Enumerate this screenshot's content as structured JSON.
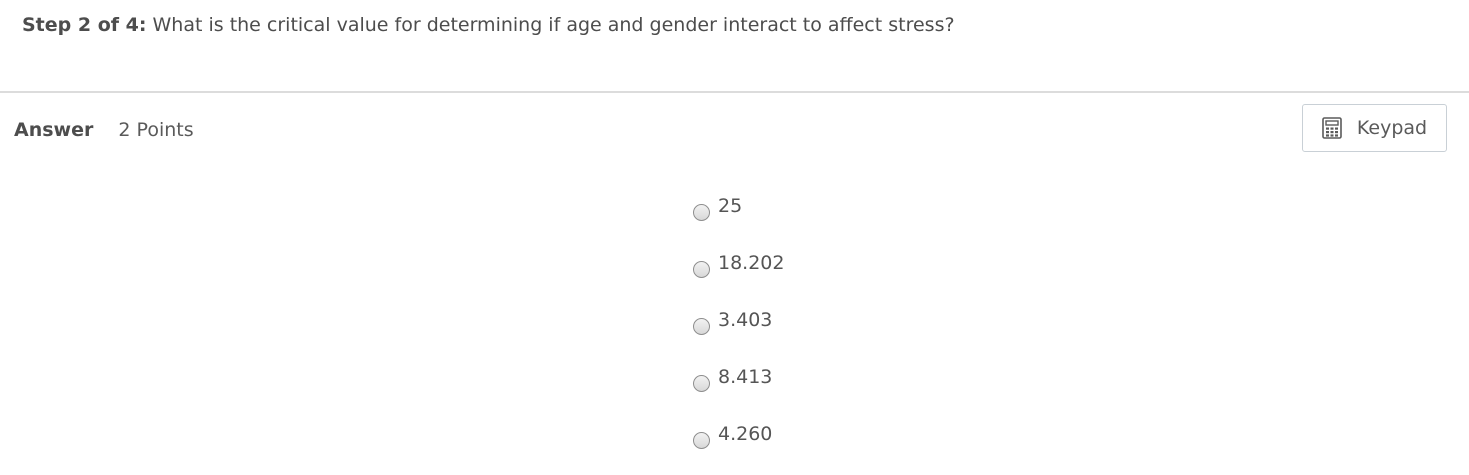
{
  "question": {
    "step_label": "Step 2 of 4:",
    "text": "What is the critical value for determining if age and gender interact to affect stress?"
  },
  "answer": {
    "label": "Answer",
    "points": "2 Points"
  },
  "keypad": {
    "label": "Keypad",
    "icon": "calculator-icon"
  },
  "options": [
    {
      "label": "25",
      "selected": false
    },
    {
      "label": "18.202",
      "selected": false
    },
    {
      "label": "3.403",
      "selected": false
    },
    {
      "label": "8.413",
      "selected": false
    },
    {
      "label": "4.260",
      "selected": false
    }
  ]
}
